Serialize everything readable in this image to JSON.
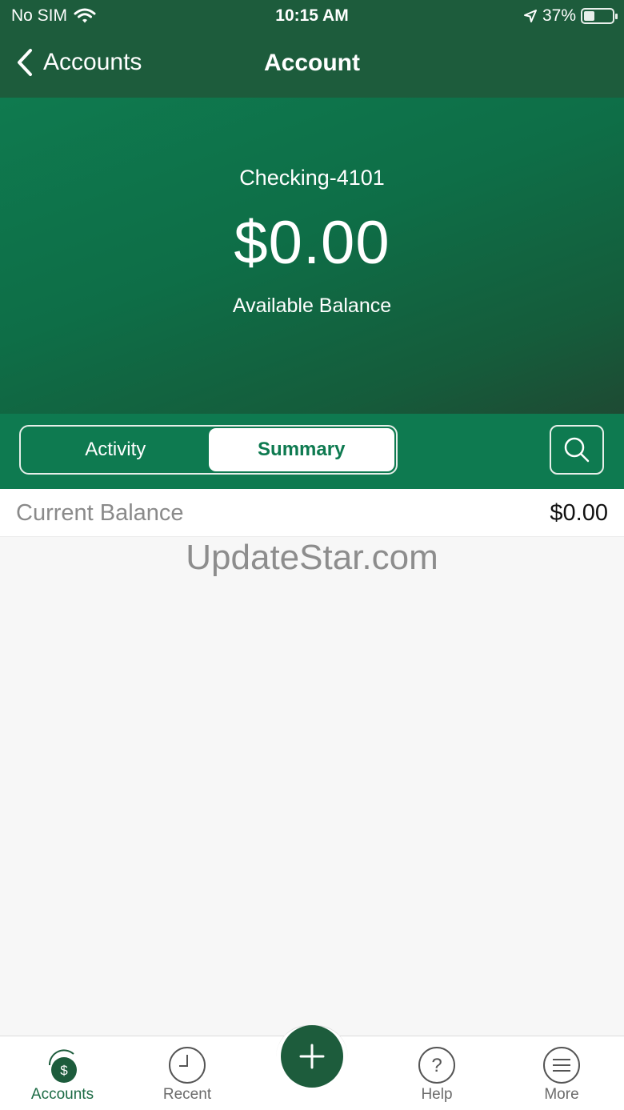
{
  "status_bar": {
    "carrier": "No SIM",
    "time": "10:15 AM",
    "battery_percent": "37%",
    "battery_level": 0.37
  },
  "nav": {
    "back_label": "Accounts",
    "title": "Account"
  },
  "account": {
    "name": "Checking-4101",
    "available_balance": "$0.00",
    "available_balance_label": "Available Balance"
  },
  "segments": {
    "activity": "Activity",
    "summary": "Summary",
    "selected": "Summary"
  },
  "summary_rows": [
    {
      "label": "Current Balance",
      "value": "$0.00"
    }
  ],
  "watermark": "UpdateStar.com",
  "tabs": {
    "accounts": "Accounts",
    "recent": "Recent",
    "help": "Help",
    "more": "More",
    "active": "Accounts"
  },
  "colors": {
    "header_green": "#1d5c3c",
    "brand_green": "#0e7a50",
    "background": "#f7f7f7"
  },
  "icons": [
    "wifi-icon",
    "location-arrow-icon",
    "battery-icon",
    "back-chevron-icon",
    "search-icon",
    "dollar-icon",
    "clock-icon",
    "plus-icon",
    "question-icon",
    "menu-icon"
  ]
}
